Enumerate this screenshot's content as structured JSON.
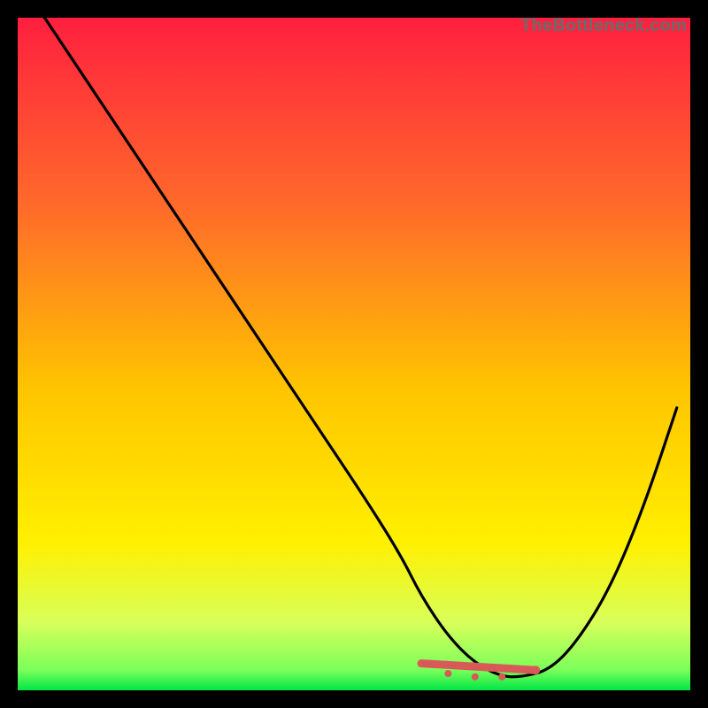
{
  "watermark": "TheBottleneck.com",
  "chart_data": {
    "type": "line",
    "title": "",
    "xlabel": "",
    "ylabel": "",
    "xlim": [
      0,
      100
    ],
    "ylim": [
      0,
      100
    ],
    "grid": false,
    "legend": false,
    "background_gradient": {
      "top_color": "#ff1f3f",
      "mid_color": "#ffe600",
      "bottom_color": "#00e645"
    },
    "series": [
      {
        "name": "curve",
        "color": "#000000",
        "x": [
          4,
          10,
          16,
          22,
          28,
          34,
          40,
          46,
          52,
          57,
          60,
          64,
          68,
          72,
          75,
          79,
          83,
          88,
          93,
          98
        ],
        "y": [
          100,
          91,
          82,
          73,
          64,
          55,
          46,
          37,
          28,
          20,
          14,
          8,
          4,
          2,
          2,
          3,
          7,
          15,
          27,
          42
        ]
      }
    ],
    "markers": [
      {
        "name": "trough-span-left",
        "x": 60,
        "y": 4,
        "color": "#d85a58",
        "r": 4
      },
      {
        "name": "trough-span-mid1",
        "x": 64,
        "y": 2.5,
        "color": "#d85a58",
        "r": 4
      },
      {
        "name": "trough-span-mid2",
        "x": 68,
        "y": 2,
        "color": "#d85a58",
        "r": 4
      },
      {
        "name": "trough-span-mid3",
        "x": 72,
        "y": 2,
        "color": "#d85a58",
        "r": 4
      },
      {
        "name": "trough-span-right",
        "x": 77,
        "y": 3,
        "color": "#d85a58",
        "r": 5
      }
    ]
  }
}
